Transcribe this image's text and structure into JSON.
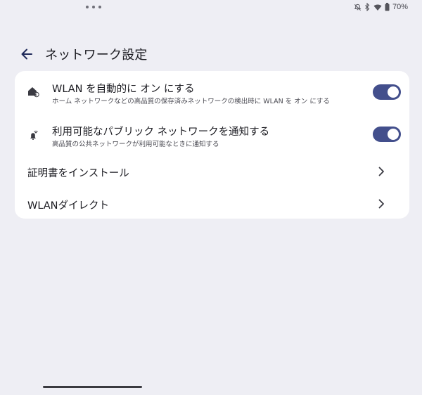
{
  "status_bar": {
    "battery_percent": "70%",
    "icons": [
      "notifications-off-icon",
      "bluetooth-icon",
      "wifi-icon",
      "battery-icon"
    ]
  },
  "header": {
    "title": "ネットワーク設定",
    "back_icon": "arrow-back-icon"
  },
  "settings": {
    "auto_wlan": {
      "title": "WLAN を自動的に オン にする",
      "subtitle": "ホーム ネットワークなどの高品質の保存済みネットワークの検出時に WLAN を オン にする",
      "icon": "home-wifi-icon",
      "enabled": true
    },
    "notify_public": {
      "title": "利用可能なパブリック ネットワークを通知する",
      "subtitle": "高品質の公共ネットワークが利用可能なときに通知する",
      "icon": "notification-wifi-icon",
      "enabled": true
    },
    "install_cert": {
      "title": "証明書をインストール"
    },
    "wlan_direct": {
      "title": "WLANダイレクト"
    }
  },
  "colors": {
    "background": "#eeeef4",
    "card": "#ffffff",
    "toggle_on": "#434f8c",
    "text_primary": "#1b1b21",
    "text_secondary": "#4a4a52"
  }
}
